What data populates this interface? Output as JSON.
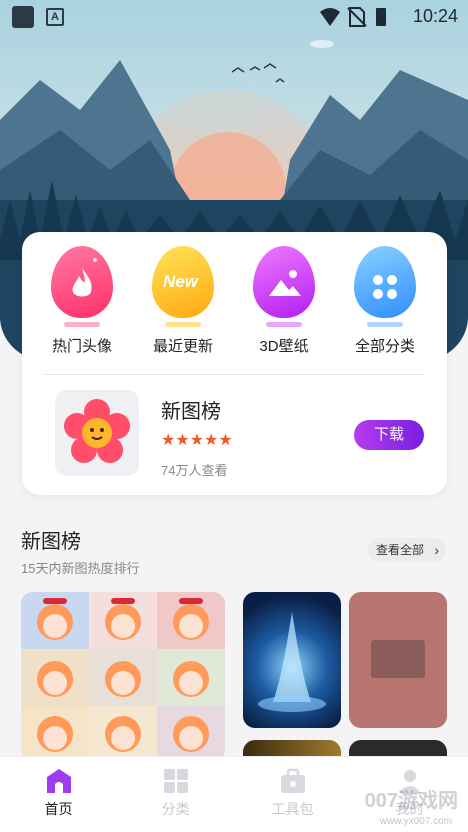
{
  "status_bar": {
    "time": "10:24"
  },
  "categories": [
    {
      "label": "热门头像",
      "color_a": "#ff5d8f",
      "color_b": "#ff2f6a",
      "icon": "flame-icon"
    },
    {
      "label": "最近更新",
      "color_a": "#ffd23a",
      "color_b": "#ffad0f",
      "icon": "new-badge-icon",
      "badge_text": "New"
    },
    {
      "label": "3D壁纸",
      "color_a": "#e35cff",
      "color_b": "#b21ff0",
      "icon": "image-icon"
    },
    {
      "label": "全部分类",
      "color_a": "#6cc2ff",
      "color_b": "#2f8dff",
      "icon": "grid-icon"
    }
  ],
  "featured": {
    "name": "新图榜",
    "rating": 5,
    "stars": "★★★★★",
    "views": "74万人查看",
    "button": "下载"
  },
  "section": {
    "title": "新图榜",
    "subtitle": "15天内新图热度排行",
    "see_all": "查看全部"
  },
  "tabs": [
    {
      "label": "首页",
      "active": true
    },
    {
      "label": "分类",
      "active": false
    },
    {
      "label": "工具包",
      "active": false
    },
    {
      "label": "我的",
      "active": false
    }
  ],
  "watermark": {
    "text": "007游戏网",
    "url": "www.yx007.com"
  }
}
